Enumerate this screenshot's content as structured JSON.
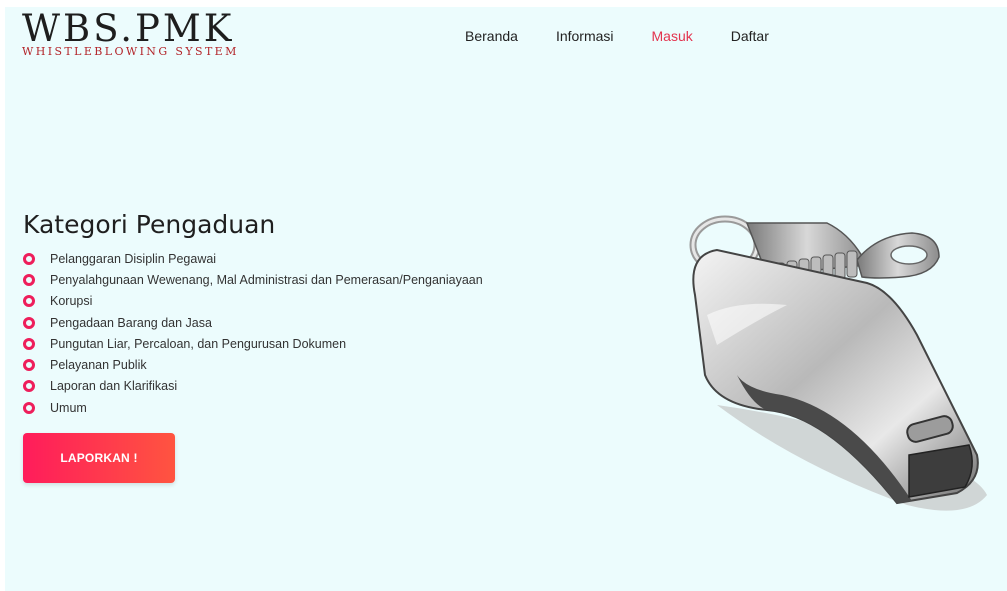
{
  "logo": {
    "main": "WBS.PMK",
    "sub": "WHISTLEBLOWING SYSTEM"
  },
  "nav": [
    {
      "label": "Beranda",
      "active": false
    },
    {
      "label": "Informasi",
      "active": false
    },
    {
      "label": "Masuk",
      "active": true
    },
    {
      "label": "Daftar",
      "active": false
    }
  ],
  "hero": {
    "title": "Kategori Pengaduan",
    "categories": [
      "Pelanggaran Disiplin Pegawai",
      "Penyalahgunaan Wewenang, Mal Administrasi dan Pemerasan/Penganiayaan",
      "Korupsi",
      "Pengadaan Barang dan Jasa",
      "Pungutan Liar, Percaloan, dan Pengurusan Dokumen",
      "Pelayanan Publik",
      "Laporan dan Klarifikasi",
      "Umum"
    ],
    "button_label": "LAPORKAN !"
  },
  "image": {
    "icon": "whistle-illustration"
  },
  "colors": {
    "accent": "#ee1e5b",
    "nav_active": "#e3344f",
    "background": "#ecfcfd"
  }
}
